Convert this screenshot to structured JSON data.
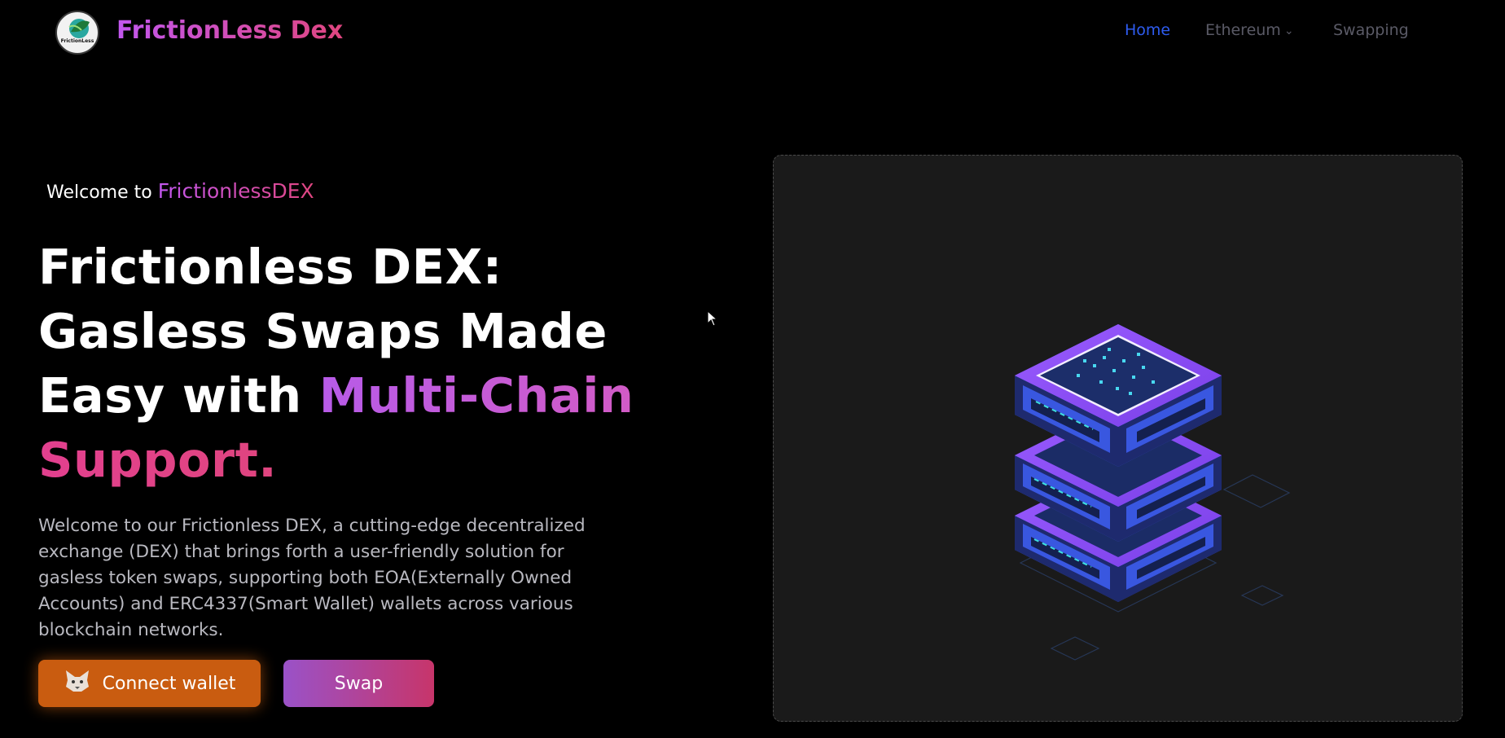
{
  "nav": {
    "brand": "FrictionLess Dex",
    "logo_caption": "FrictionLess",
    "links": {
      "home": "Home",
      "network": "Ethereum",
      "swapping": "Swapping"
    },
    "icons": {
      "network_dropdown": "chevron-down-icon"
    }
  },
  "hero": {
    "welcome_prefix": "Welcome to ",
    "welcome_accent": "FrictionlessDEX",
    "headline": {
      "line1": "Frictionless DEX:",
      "line2": "Gasless Swaps Made",
      "line3_plain": "Easy with ",
      "line3_accent": "Multi-Chain",
      "line4_accent": "Support."
    },
    "description": "Welcome to our Frictionless DEX, a cutting-edge decentralized exchange (DEX) that brings forth a user-friendly solution for gasless token swaps, supporting both EOA(Externally Owned Accounts) and ERC4337(Smart Wallet) wallets across various blockchain networks.",
    "buttons": {
      "connect_wallet": "Connect wallet",
      "swap": "Swap"
    },
    "icons": {
      "connect_wallet": "fox-icon"
    }
  },
  "illustration": {
    "icon": "server-stack-icon"
  },
  "colors": {
    "background": "#000000",
    "panel": "#1a1a1a",
    "nav_active": "#2e5cf0",
    "accent_purple": "#c257ef",
    "accent_pink": "#e0457f",
    "connect_button": "#c95c10",
    "stack_purple": "#8a4cf0",
    "stack_blue": "#3f5fe6"
  }
}
